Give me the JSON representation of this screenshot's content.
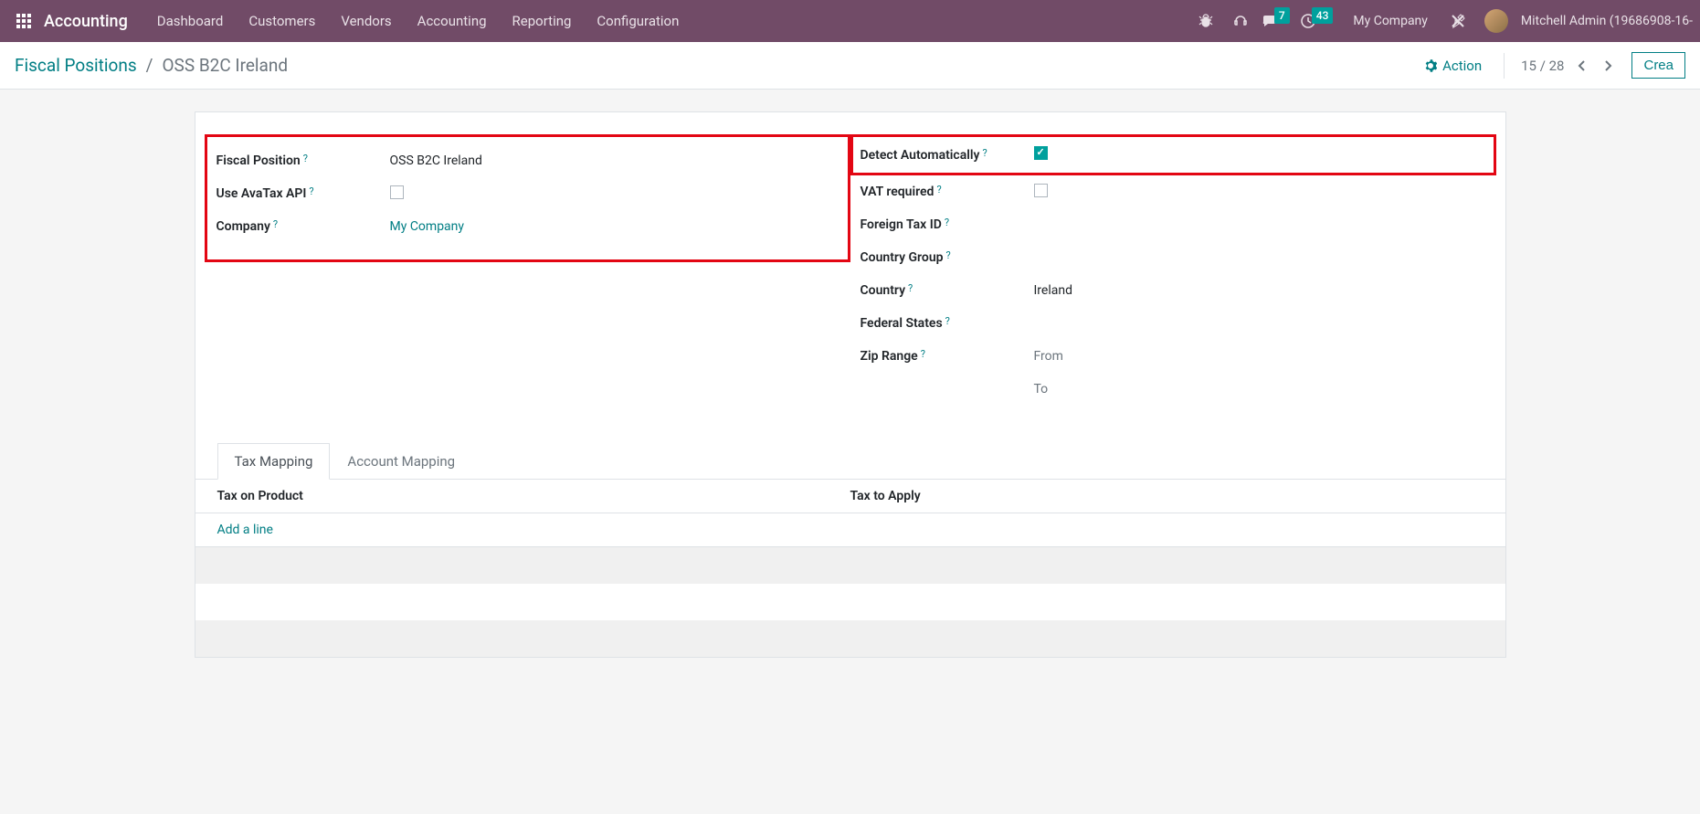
{
  "topbar": {
    "app_name": "Accounting",
    "menu": [
      "Dashboard",
      "Customers",
      "Vendors",
      "Accounting",
      "Reporting",
      "Configuration"
    ],
    "badge_messages": "7",
    "badge_activities": "43",
    "company": "My Company",
    "user": "Mitchell Admin (19686908-16-"
  },
  "controlbar": {
    "breadcrumb_root": "Fiscal Positions",
    "breadcrumb_sep": "/",
    "breadcrumb_current": "OSS B2C Ireland",
    "action_label": "Action",
    "pager": "15 / 28",
    "create_label": "Crea"
  },
  "form": {
    "left": {
      "fiscal_position_label": "Fiscal Position",
      "fiscal_position_value": "OSS B2C Ireland",
      "use_avatax_label": "Use AvaTax API",
      "company_label": "Company",
      "company_value": "My Company"
    },
    "right": {
      "detect_auto_label": "Detect Automatically",
      "vat_required_label": "VAT required",
      "foreign_tax_label": "Foreign Tax ID",
      "country_group_label": "Country Group",
      "country_label": "Country",
      "country_value": "Ireland",
      "federal_states_label": "Federal States",
      "zip_range_label": "Zip Range",
      "zip_from_placeholder": "From",
      "zip_to_placeholder": "To"
    }
  },
  "tabs": {
    "tax_mapping": "Tax Mapping",
    "account_mapping": "Account Mapping"
  },
  "table": {
    "col_tax_product": "Tax on Product",
    "col_tax_apply": "Tax to Apply",
    "add_line": "Add a line"
  },
  "help_glyph": "?"
}
